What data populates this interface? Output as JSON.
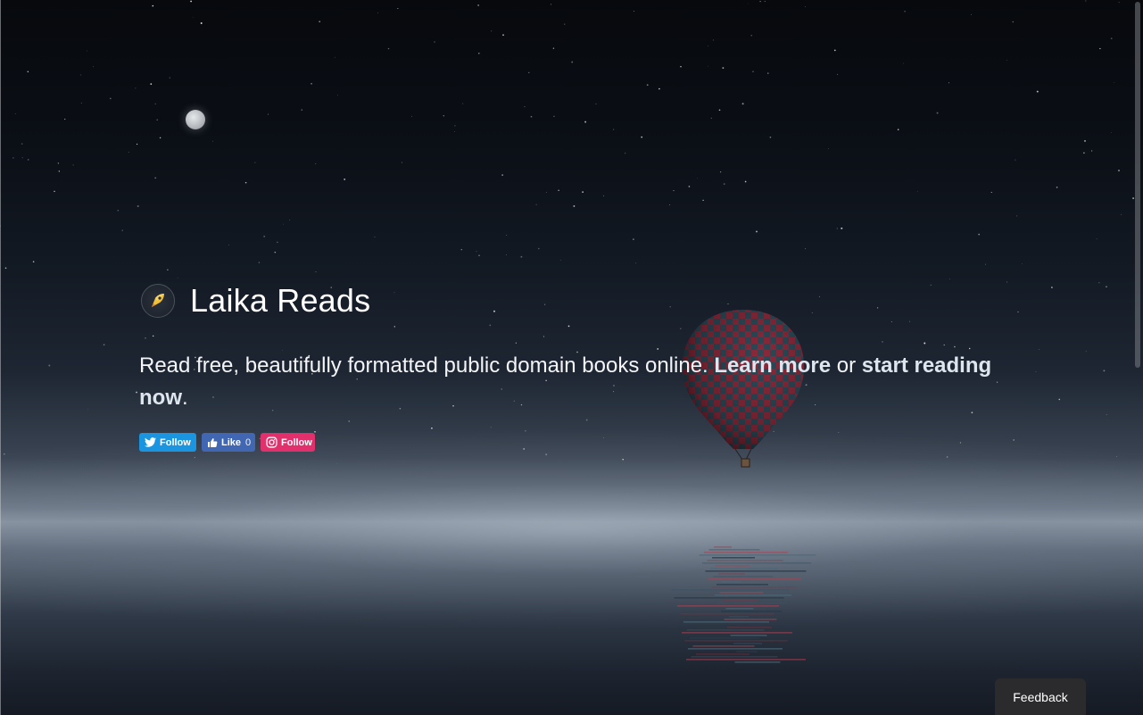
{
  "site": {
    "title": "Laika Reads",
    "logo_icon": "rocket-dog-icon"
  },
  "tagline": {
    "text_before": "Read free, beautifully formatted public domain books online. ",
    "learn_more": "Learn more",
    "text_middle": " or ",
    "start_reading": "start reading now",
    "text_after": "."
  },
  "social": {
    "twitter_label": "Follow",
    "facebook_label": "Like",
    "facebook_count": "0",
    "instagram_label": "Follow"
  },
  "feedback_label": "Feedback",
  "colors": {
    "twitter": "#1b95e0",
    "facebook": "#4267b2",
    "instagram": "#e1306c",
    "feedback_bg": "#2b2b2d"
  }
}
